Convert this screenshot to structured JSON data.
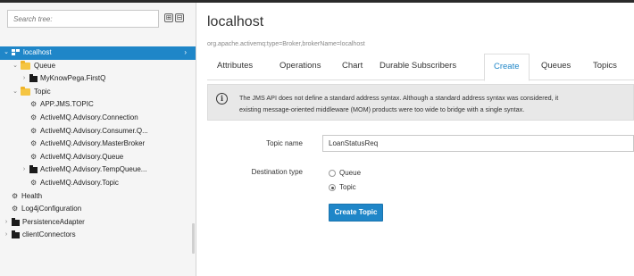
{
  "sidebar": {
    "search_placeholder": "Search tree:",
    "expand_all": "⊞",
    "collapse_all": "⊟",
    "tree": [
      {
        "label": "localhost",
        "selected": true
      },
      {
        "label": "Queue"
      },
      {
        "label": "MyKnowPega.FirstQ"
      },
      {
        "label": "Topic"
      },
      {
        "label": "APP.JMS.TOPIC"
      },
      {
        "label": "ActiveMQ.Advisory.Connection"
      },
      {
        "label": "ActiveMQ.Advisory.Consumer.Q..."
      },
      {
        "label": "ActiveMQ.Advisory.MasterBroker"
      },
      {
        "label": "ActiveMQ.Advisory.Queue"
      },
      {
        "label": "ActiveMQ.Advisory.TempQueue..."
      },
      {
        "label": "ActiveMQ.Advisory.Topic"
      },
      {
        "label": "Health"
      },
      {
        "label": "Log4jConfiguration"
      },
      {
        "label": "PersistenceAdapter"
      },
      {
        "label": "clientConnectors"
      }
    ]
  },
  "main": {
    "title": "localhost",
    "subtitle": "org.apache.activemq:type=Broker,brokerName=localhost",
    "tabs": [
      {
        "label": "Attributes"
      },
      {
        "label": "Operations"
      },
      {
        "label": "Chart"
      },
      {
        "label": "Durable Subscribers"
      },
      {
        "label": "Create",
        "active": true
      },
      {
        "label": "Queues"
      },
      {
        "label": "Topics"
      }
    ],
    "alert": {
      "line1": "The JMS API does not define a standard address syntax. Although a standard address syntax was considered, it",
      "line2": "existing message-oriented middleware (MOM) products were too wide to bridge with a single syntax."
    },
    "form": {
      "topic_name_label": "Topic name",
      "topic_name_value": "LoanStatusReq",
      "destination_type_label": "Destination type",
      "options": [
        {
          "label": "Queue",
          "checked": false
        },
        {
          "label": "Topic",
          "checked": true
        }
      ],
      "submit_label": "Create Topic"
    }
  },
  "colors": {
    "accent": "#1f86c8",
    "folder": "#f0b429",
    "alert_bg": "#e8e8e8"
  }
}
